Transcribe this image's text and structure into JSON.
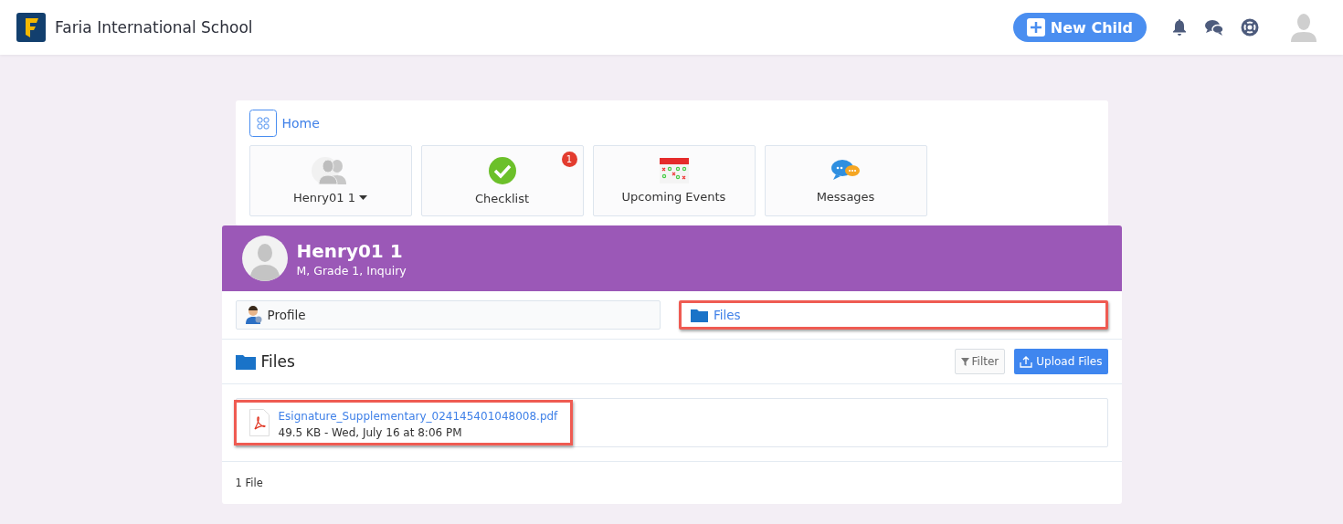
{
  "header": {
    "school": "Faria International School",
    "new_button": "New Child"
  },
  "home": {
    "label": "Home"
  },
  "tiles": [
    {
      "kind": "people",
      "label": "Henry01 1",
      "dropdown": true
    },
    {
      "kind": "check",
      "label": "Checklist",
      "badge": "1",
      "dropdown": false
    },
    {
      "kind": "calendar",
      "label": "Upcoming Events",
      "dropdown": false
    },
    {
      "kind": "messages",
      "label": "Messages",
      "dropdown": false
    }
  ],
  "student": {
    "name": "Henry01 1",
    "details": "M, Grade 1, Inquiry"
  },
  "tabs": [
    {
      "kind": "profile",
      "label": "Profile",
      "selected": false,
      "highlighted": false
    },
    {
      "kind": "files",
      "label": "Files",
      "selected": true,
      "highlighted": true
    }
  ],
  "files": {
    "title": "Files",
    "filter": "Filter",
    "upload": "Upload Files",
    "items": [
      {
        "name": "Esignature_Supplementary_024145401048008.pdf",
        "meta": "49.5 KB - Wed, July 16 at 8:06 PM",
        "highlighted": true
      }
    ],
    "count": "1 File"
  }
}
